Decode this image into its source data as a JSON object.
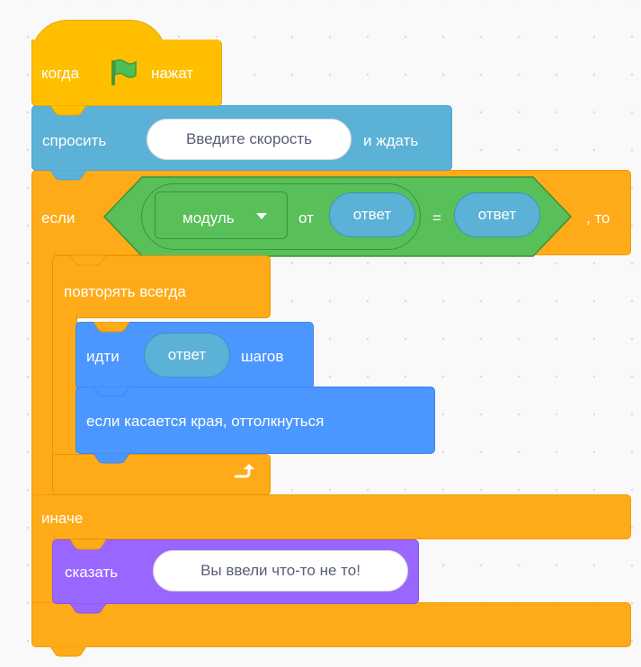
{
  "scripts": {
    "when_flag": {
      "pre_label": "когда",
      "post_label": "нажат",
      "icon": "green-flag-icon"
    },
    "ask": {
      "label": "спросить",
      "input_value": "Введите скорость",
      "suffix": "и ждать"
    },
    "if_else": {
      "if_label": "если",
      "then_label": ", то",
      "else_label": "иначе",
      "condition": {
        "function_dropdown": "модуль",
        "of_label": "от",
        "arg_reporter": "ответ",
        "equals": "=",
        "right_reporter": "ответ"
      }
    },
    "forever": {
      "label": "повторять всегда",
      "loop_icon": "loop-arrow-icon"
    },
    "move": {
      "pre_label": "идти",
      "reporter": "ответ",
      "post_label": "шагов"
    },
    "bounce": {
      "label": "если касается края, оттолкнуться"
    },
    "say": {
      "label": "сказать",
      "input_value": "Вы ввели что-то не то!"
    }
  },
  "colors": {
    "events": "#ffbf00",
    "sensing": "#5cb1d6",
    "control": "#ffab19",
    "motion": "#4c97ff",
    "looks": "#9966ff",
    "operators": "#59c059",
    "background": "#f9f9f9"
  }
}
